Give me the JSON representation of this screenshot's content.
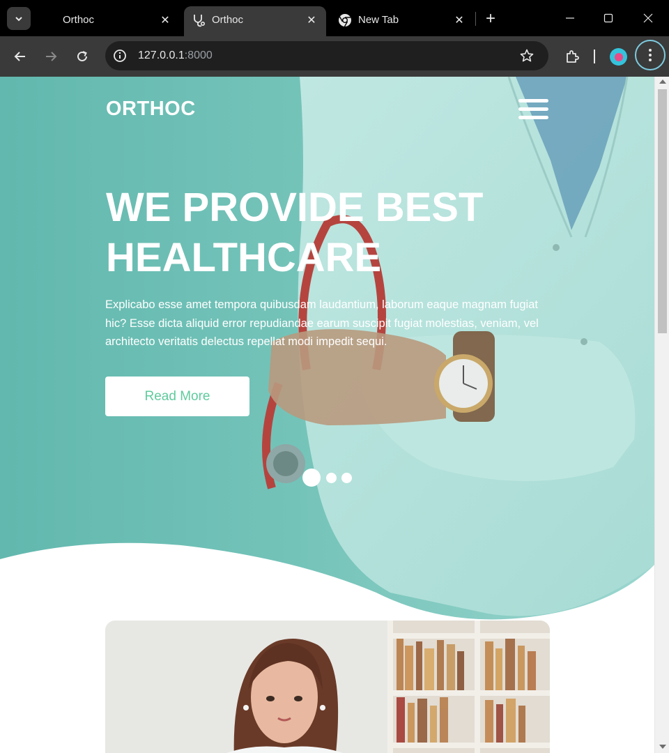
{
  "browser": {
    "tabs": [
      {
        "title": "Orthoc",
        "active": false
      },
      {
        "title": "Orthoc",
        "active": true
      },
      {
        "title": "New Tab",
        "active": false
      }
    ],
    "url_host": "127.0.0.1",
    "url_port": ":8000",
    "close_glyph": "✕",
    "new_tab_glyph": "+"
  },
  "site": {
    "brand": "ORTHOC",
    "hero": {
      "title": "WE PROVIDE BEST HEALTHCARE",
      "text": "Explicabo esse amet tempora quibusdam laudantium, laborum eaque magnam fugiat hic? Esse dicta aliquid error repudiandae earum suscipit fugiat molestias, veniam, vel architecto veritatis delectus repellat modi impedit sequi.",
      "button": "Read More",
      "carousel_slides": 3,
      "carousel_active": 1
    }
  },
  "colors": {
    "hero_teal": "#6cc0b7",
    "accent_green": "#5fcb9d",
    "chrome_dark": "#000000",
    "chrome_toolbar": "#3a3a3a"
  }
}
